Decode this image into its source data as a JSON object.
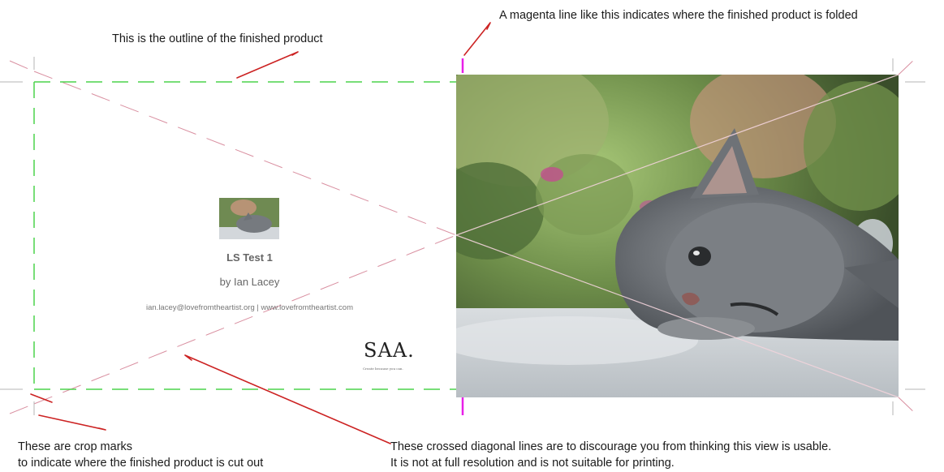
{
  "annotations": {
    "outline_note": "This is the outline of the finished product",
    "fold_note": "A magenta line like this indicates where the finished product is folded",
    "crop_note_line1": "These are crop marks",
    "crop_note_line2": "to indicate where the finished product is cut out",
    "diagonal_note_line1": "These crossed diagonal lines are to discourage you from thinking this view is usable.",
    "diagonal_note_line2": "It is not at full resolution and is not suitable for printing."
  },
  "back_cover": {
    "title": "LS Test 1",
    "author": "by Ian Lacey",
    "contact": "ian.lacey@lovefromtheartist.org | www.lovefromtheartist.com",
    "thumbnail": "kitten-photo-thumbnail"
  },
  "logo": {
    "text": "SAA.",
    "tagline": "Create because you can."
  },
  "front_cover": {
    "image": "grey-kitten-lying-on-white-blanket-photo"
  },
  "colors": {
    "outline": "#4cd34c",
    "fold": "#e81fe8",
    "crop_marks": "#b5b5b5",
    "diagonals": "#d98fa0",
    "pointers": "#cc2222"
  }
}
